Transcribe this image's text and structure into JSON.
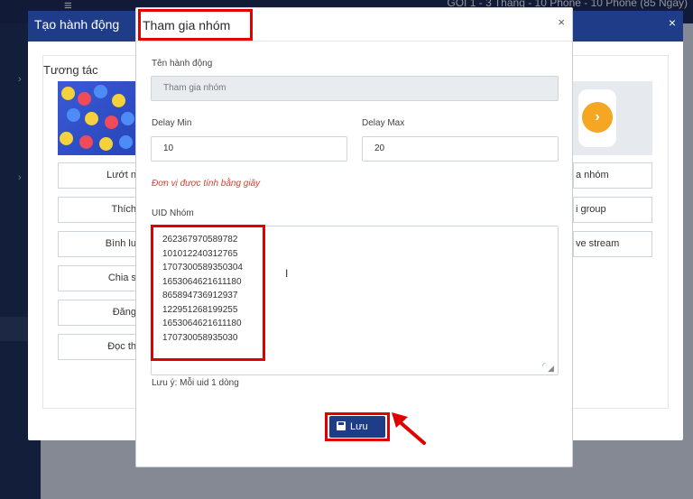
{
  "app": {
    "plan_text": "GÓI 1 - 3 Tháng - 10 Phone - 10 Phone (85 Ngày)"
  },
  "back_modal": {
    "title": "Tạo hành động",
    "section_title": "Tương tác",
    "actions_left": [
      "Lướt n",
      "Thích",
      "Bình lu",
      "Chia s",
      "Đăng",
      "Đọc th"
    ],
    "actions_right": [
      "a nhóm",
      "i group",
      "ve stream"
    ]
  },
  "front_modal": {
    "title": "Tham gia nhóm",
    "action_name_label": "Tên hành động",
    "action_name_value": "Tham gia nhóm",
    "delay_min_label": "Delay Min",
    "delay_min_value": "10",
    "delay_max_label": "Delay Max",
    "delay_max_value": "20",
    "unit_note": "Đơn vị được tính bằng giây",
    "uid_label": "UID Nhóm",
    "uids": [
      "262367970589782",
      "101012240312765",
      "1707300589350304",
      "1653064621611180",
      "865894736912937",
      "122951268199255",
      "1653064621611180",
      "170730058935030"
    ],
    "uid_note": "Lưu ý: Mỗi uid 1 dòng",
    "save_label": "Lưu"
  },
  "colors": {
    "navy": "#1f3c88",
    "highlight": "#e00000",
    "note_red": "#e53935"
  }
}
